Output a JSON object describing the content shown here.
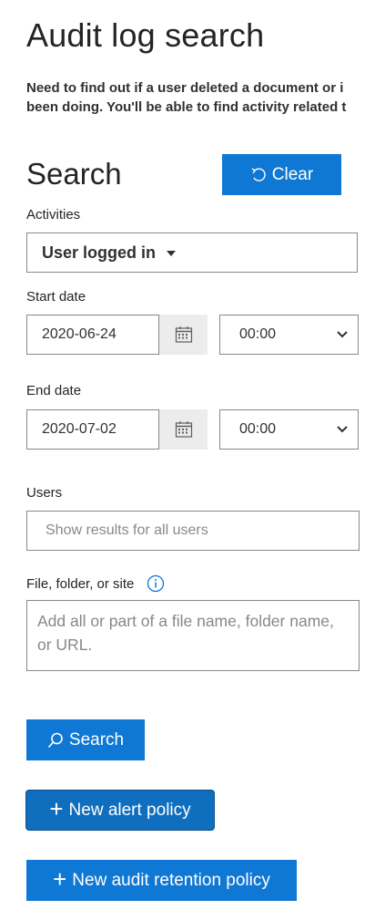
{
  "page": {
    "title": "Audit log search",
    "description_line1": "Need to find out if a user deleted a document or i",
    "description_line2": "been doing. You'll be able to find activity related t"
  },
  "search_section": {
    "title": "Search",
    "clear_label": "Clear"
  },
  "activities": {
    "label": "Activities",
    "selected": "User logged in"
  },
  "start_date": {
    "label": "Start date",
    "date": "2020-06-24",
    "time": "00:00"
  },
  "end_date": {
    "label": "End date",
    "date": "2020-07-02",
    "time": "00:00"
  },
  "users": {
    "label": "Users",
    "placeholder": "Show results for all users"
  },
  "file_folder_site": {
    "label": "File, folder, or site",
    "placeholder": "Add all or part of a file name, folder name, or URL."
  },
  "buttons": {
    "search_label": "Search",
    "new_alert_policy_label": "New alert policy",
    "new_audit_retention_policy_label": "New audit retention policy"
  },
  "icons": {
    "clear": "undo-icon",
    "calendar": "calendar-icon",
    "dropdown": "chevron-down-icon",
    "info": "info-icon",
    "search": "search-icon",
    "add": "plus-icon"
  },
  "colors": {
    "primary_button": "#0f78d4",
    "alert_button": "#106ebe",
    "border": "#8a8886",
    "calendar_button": "#ececec",
    "info_icon": "#0f78d4"
  }
}
